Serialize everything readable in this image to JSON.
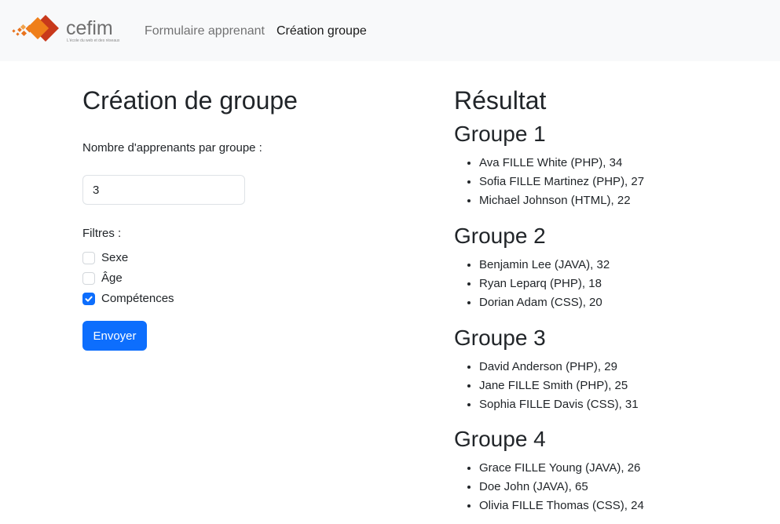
{
  "navbar": {
    "logo_text": "cefim",
    "logo_tagline": "L'école du web et des réseaux",
    "links": [
      {
        "label": "Formulaire apprenant"
      },
      {
        "label": "Création groupe"
      }
    ]
  },
  "form": {
    "title": "Création de groupe",
    "count_label": "Nombre d'apprenants par groupe :",
    "count_value": "3",
    "filters_label": "Filtres :",
    "filters": [
      {
        "label": "Sexe",
        "checked": false
      },
      {
        "label": "Âge",
        "checked": false
      },
      {
        "label": "Compétences",
        "checked": true
      }
    ],
    "submit_label": "Envoyer"
  },
  "result": {
    "title": "Résultat",
    "groups": [
      {
        "title": "Groupe 1",
        "members": [
          "Ava FILLE White (PHP), 34",
          "Sofia FILLE Martinez (PHP), 27",
          "Michael Johnson (HTML), 22"
        ]
      },
      {
        "title": "Groupe 2",
        "members": [
          "Benjamin Lee (JAVA), 32",
          "Ryan Leparq (PHP), 18",
          "Dorian Adam (CSS), 20"
        ]
      },
      {
        "title": "Groupe 3",
        "members": [
          "David Anderson (PHP), 29",
          "Jane FILLE Smith (PHP), 25",
          "Sophia FILLE Davis (CSS), 31"
        ]
      },
      {
        "title": "Groupe 4",
        "members": [
          "Grace FILLE Young (JAVA), 26",
          "Doe John (JAVA), 65",
          "Olivia FILLE Thomas (CSS), 24"
        ]
      }
    ]
  },
  "colors": {
    "primary": "#0d6efd",
    "navbar_bg": "#f8f9fa",
    "logo_orange": "#e8731d",
    "logo_red": "#c8391b"
  }
}
